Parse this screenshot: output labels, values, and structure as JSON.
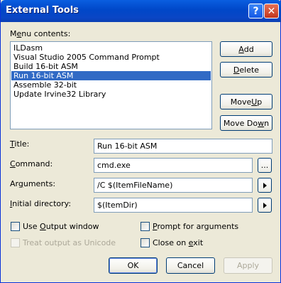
{
  "window": {
    "title": "External Tools",
    "help_icon": "help-icon",
    "close_icon": "close-icon"
  },
  "menu": {
    "label_pre": "M",
    "label_u": "e",
    "label_post": "nu contents:",
    "items": [
      {
        "label": "ILDasm",
        "selected": false
      },
      {
        "label": "Visual Studio 2005 Command Prompt",
        "selected": false
      },
      {
        "label": "Build 16-bit ASM",
        "selected": false
      },
      {
        "label": "Run 16-bit ASM",
        "selected": true
      },
      {
        "label": "Assemble 32-bit",
        "selected": false
      },
      {
        "label": "Update Irvine32 Library",
        "selected": false
      }
    ]
  },
  "buttons": {
    "add": {
      "pre": "",
      "u": "A",
      "post": "dd"
    },
    "delete": {
      "pre": "",
      "u": "D",
      "post": "elete"
    },
    "move_up": {
      "pre": "Move ",
      "u": "U",
      "post": "p"
    },
    "move_down": {
      "pre": "Move Do",
      "u": "w",
      "post": "n"
    },
    "ok": "OK",
    "cancel": "Cancel",
    "apply": "Apply"
  },
  "fields": {
    "title": {
      "label_u": "T",
      "label_post": "itle:",
      "value": "Run 16-bit ASM"
    },
    "command": {
      "label_u": "C",
      "label_post": "ommand:",
      "value": "cmd.exe",
      "browse": "..."
    },
    "arguments": {
      "label_pre": "Ar",
      "label_u": "g",
      "label_post": "uments:",
      "value": "/C $(ItemFileName)"
    },
    "initial_directory": {
      "label_u": "I",
      "label_post": "nitial directory:",
      "value": "$(ItemDir)"
    }
  },
  "options": {
    "use_output_window": {
      "pre": "Use ",
      "u": "O",
      "post": "utput window",
      "checked": false
    },
    "treat_unicode": {
      "label": "Treat output as Unicode",
      "checked": false,
      "enabled": false
    },
    "prompt_args": {
      "pre": "",
      "u": "P",
      "post": "rompt for arguments",
      "checked": false
    },
    "close_on_exit": {
      "pre": "Close on ",
      "u": "e",
      "post": "xit",
      "checked": false
    }
  }
}
